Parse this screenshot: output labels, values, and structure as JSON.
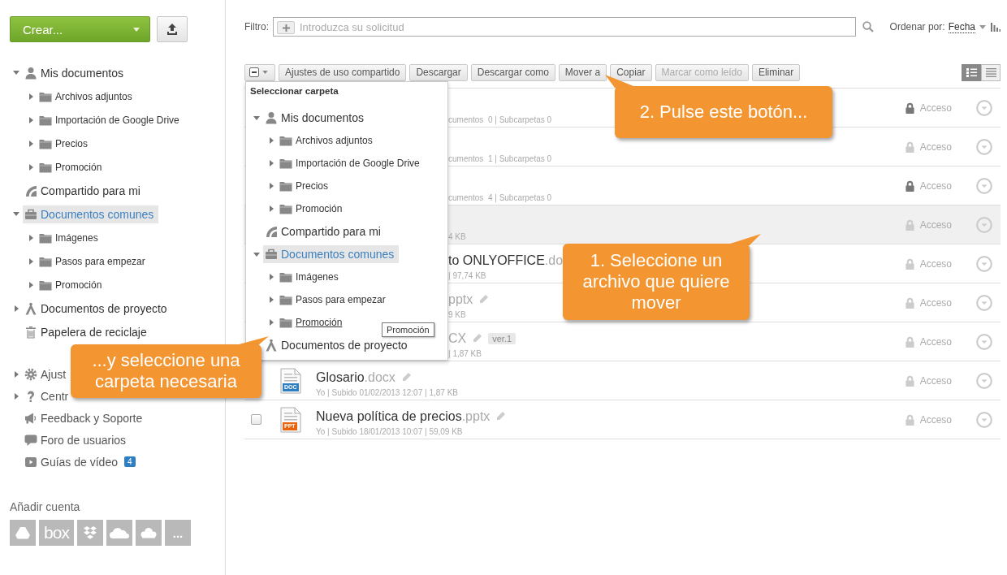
{
  "sidebar": {
    "create_button": {
      "label": "Crear..."
    },
    "tree": [
      {
        "label": "Mis documentos",
        "kind": "person",
        "expanded": true,
        "selected": false,
        "children": [
          {
            "label": "Archivos adjuntos",
            "kind": "folder",
            "expanded": false,
            "selected": false
          },
          {
            "label": "Importación de Google Drive",
            "kind": "folder",
            "expanded": false,
            "selected": false
          },
          {
            "label": "Precios",
            "kind": "folder",
            "expanded": false,
            "selected": false
          },
          {
            "label": "Promoción",
            "kind": "folder",
            "expanded": false,
            "selected": false
          }
        ]
      },
      {
        "label": "Compartido para mi",
        "kind": "shared",
        "selected": false
      },
      {
        "label": "Documentos comunes",
        "kind": "briefcase",
        "expanded": true,
        "selected": true,
        "children": [
          {
            "label": "Imágenes",
            "kind": "folder",
            "expanded": false,
            "selected": false
          },
          {
            "label": "Pasos para empezar",
            "kind": "folder",
            "expanded": false,
            "selected": false
          },
          {
            "label": "Promoción",
            "kind": "folder",
            "expanded": false,
            "selected": false
          }
        ]
      },
      {
        "label": "Documentos de proyecto",
        "kind": "project",
        "expanded": false,
        "selected": false
      },
      {
        "label": "Papelera de reciclaje",
        "kind": "trash",
        "selected": false
      }
    ],
    "links": [
      {
        "label": "Ajust",
        "kind": "gear",
        "expandable": true
      },
      {
        "label": "Centr",
        "kind": "question",
        "expandable": true
      },
      {
        "label": "Feedback y Soporte",
        "kind": "megaphone",
        "expandable": false
      },
      {
        "label": "Foro de usuarios",
        "kind": "bubble",
        "expandable": false
      },
      {
        "label": "Guías de vídeo",
        "kind": "play",
        "expandable": false,
        "badge": "4"
      }
    ],
    "add_account": {
      "label": "Añadir cuenta",
      "services": [
        {
          "kind": "drive"
        },
        {
          "kind": "box",
          "label": "box"
        },
        {
          "kind": "dropbox"
        },
        {
          "kind": "onedrive"
        },
        {
          "kind": "owncloud"
        },
        {
          "kind": "more",
          "label": "..."
        }
      ]
    }
  },
  "filter": {
    "label": "Filtro:",
    "placeholder": "Introduzca su solicitud"
  },
  "sort": {
    "label": "Ordenar por:",
    "value": "Fecha"
  },
  "toolbar": {
    "buttons": [
      {
        "label": "Ajustes de uso compartido",
        "disabled": false
      },
      {
        "label": "Descargar",
        "disabled": false
      },
      {
        "label": "Descargar como",
        "disabled": false
      },
      {
        "label": "Mover a",
        "disabled": false
      },
      {
        "label": "Copiar",
        "disabled": false
      },
      {
        "label": "Marcar como leído",
        "disabled": true
      },
      {
        "label": "Eliminar",
        "disabled": false
      }
    ],
    "views": [
      {
        "kind": "tiles",
        "selected": true
      },
      {
        "kind": "list",
        "selected": false
      }
    ]
  },
  "files": [
    {
      "meta": "cumentos  0 | Subcarpetas 0",
      "editable": false,
      "locked": true,
      "selected": false,
      "access": "Acceso"
    },
    {
      "meta": "cumentos  1 | Subcarpetas 0",
      "editable": false,
      "locked": false,
      "selected": false,
      "access": "Acceso"
    },
    {
      "meta": "cumentos  4 | Subcarpetas 0",
      "editable": false,
      "locked": true,
      "selected": false,
      "access": "Acceso"
    },
    {
      "meta": "4 KB",
      "editable": false,
      "locked": false,
      "selected": true,
      "access": "Acceso"
    },
    {
      "name": "to ONLYOFFICE",
      "ext": ".do",
      "meta": "| 97,74 KB",
      "editable": false,
      "locked": false,
      "selected": false,
      "access": "Acceso"
    },
    {
      "ext": "pptx",
      "meta": "9 KB",
      "editable": true,
      "locked": false,
      "selected": false,
      "access": "Acceso"
    },
    {
      "ext": "CX",
      "version": "ver.1",
      "meta": "| 1,87 KB",
      "editable": true,
      "locked": false,
      "selected": false,
      "access": "Acceso"
    },
    {
      "kind": "doc",
      "type_label": "DOC",
      "name": "Glosario",
      "ext": ".docx",
      "meta": "Yo | Subido 01/02/2013 12:07 | 1,87 KB",
      "editable": true,
      "locked": false,
      "selected": false,
      "access": "Acceso"
    },
    {
      "kind": "ppt",
      "type_label": "PPT",
      "checkbox": {
        "checked": false
      },
      "name": "Nueva política de precios",
      "ext": ".pptx",
      "meta": "Yo | Subido 18/01/2013 10:07 | 59,09 KB",
      "editable": true,
      "locked": false,
      "selected": false,
      "access": "Acceso"
    }
  ],
  "folder_menu": {
    "title": "Seleccionar carpeta",
    "tooltip": "Promoción",
    "tree": [
      {
        "label": "Mis documentos",
        "kind": "person",
        "expanded": true,
        "selected": false,
        "hovered": false,
        "children": [
          {
            "label": "Archivos adjuntos",
            "kind": "folder",
            "expanded": false,
            "selected": false,
            "hovered": false
          },
          {
            "label": "Importación de Google Drive",
            "kind": "folder",
            "expanded": false,
            "selected": false,
            "hovered": false
          },
          {
            "label": "Precios",
            "kind": "folder",
            "expanded": false,
            "selected": false,
            "hovered": false
          },
          {
            "label": "Promoción",
            "kind": "folder",
            "expanded": false,
            "selected": false,
            "hovered": false
          }
        ]
      },
      {
        "label": "Compartido para mi",
        "kind": "shared",
        "selected": false,
        "hovered": false
      },
      {
        "label": "Documentos comunes",
        "kind": "briefcase",
        "expanded": true,
        "selected": true,
        "hovered": false,
        "children": [
          {
            "label": "Imágenes",
            "kind": "folder",
            "expanded": false,
            "selected": false,
            "hovered": false
          },
          {
            "label": "Pasos para empezar",
            "kind": "folder",
            "expanded": false,
            "selected": false,
            "hovered": false
          },
          {
            "label": "Promoción",
            "kind": "folder",
            "expanded": false,
            "selected": false,
            "hovered": true
          }
        ]
      },
      {
        "label": "Documentos de proyecto",
        "kind": "project",
        "expanded": false,
        "selected": false,
        "hovered": false
      }
    ]
  },
  "callouts": [
    {
      "text": "2. Pulse este botón..."
    },
    {
      "text": "1. Seleccione un archivo que quiere mover"
    },
    {
      "text": "...y seleccione una carpeta necesaria"
    }
  ]
}
